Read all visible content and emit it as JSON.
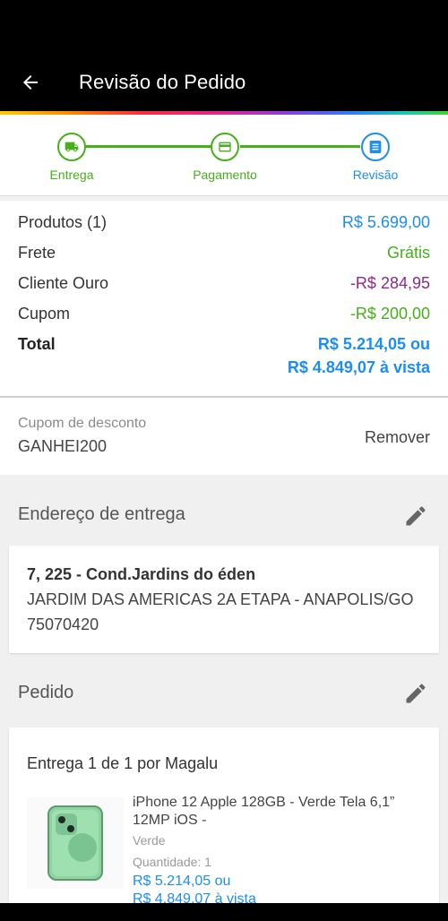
{
  "header": {
    "title": "Revisão do Pedido"
  },
  "steps": [
    {
      "label": "Entrega"
    },
    {
      "label": "Pagamento"
    },
    {
      "label": "Revisão"
    }
  ],
  "summary": {
    "produtos_label": "Produtos (1)",
    "produtos_value": "R$ 5.699,00",
    "frete_label": "Frete",
    "frete_value": "Grátis",
    "cliente_label": "Cliente Ouro",
    "cliente_value": "-R$ 284,95",
    "cupom_label": "Cupom",
    "cupom_value": "-R$ 200,00",
    "total_label": "Total",
    "total_value": "R$ 5.214,05 ou",
    "total_vista": "R$ 4.849,07 à vista"
  },
  "coupon": {
    "label": "Cupom de desconto",
    "code": "GANHEI200",
    "remove_label": "Remover"
  },
  "address": {
    "section_title": "Endereço de entrega",
    "line1": "7, 225 - Cond.Jardins do éden",
    "line2": "JARDIM DAS AMERICAS 2A ETAPA - ANAPOLIS/GO",
    "line3": "75070420"
  },
  "order": {
    "section_title": "Pedido",
    "entrega": "Entrega 1 de 1 por Magalu",
    "product_name": "iPhone 12 Apple 128GB - Verde Tela 6,1” 12MP iOS -",
    "product_color": "Verde",
    "product_qty": "Quantidade:  1",
    "product_price": "R$ 5.214,05 ou",
    "product_price_vista": "R$ 4.849,07 à vista"
  },
  "colors": {
    "green": "#45b01a",
    "blue": "#1d8ef0",
    "purple": "#8c2a8c"
  },
  "icons": [
    "back-arrow-icon",
    "truck-icon",
    "card-icon",
    "document-icon",
    "pencil-icon"
  ]
}
